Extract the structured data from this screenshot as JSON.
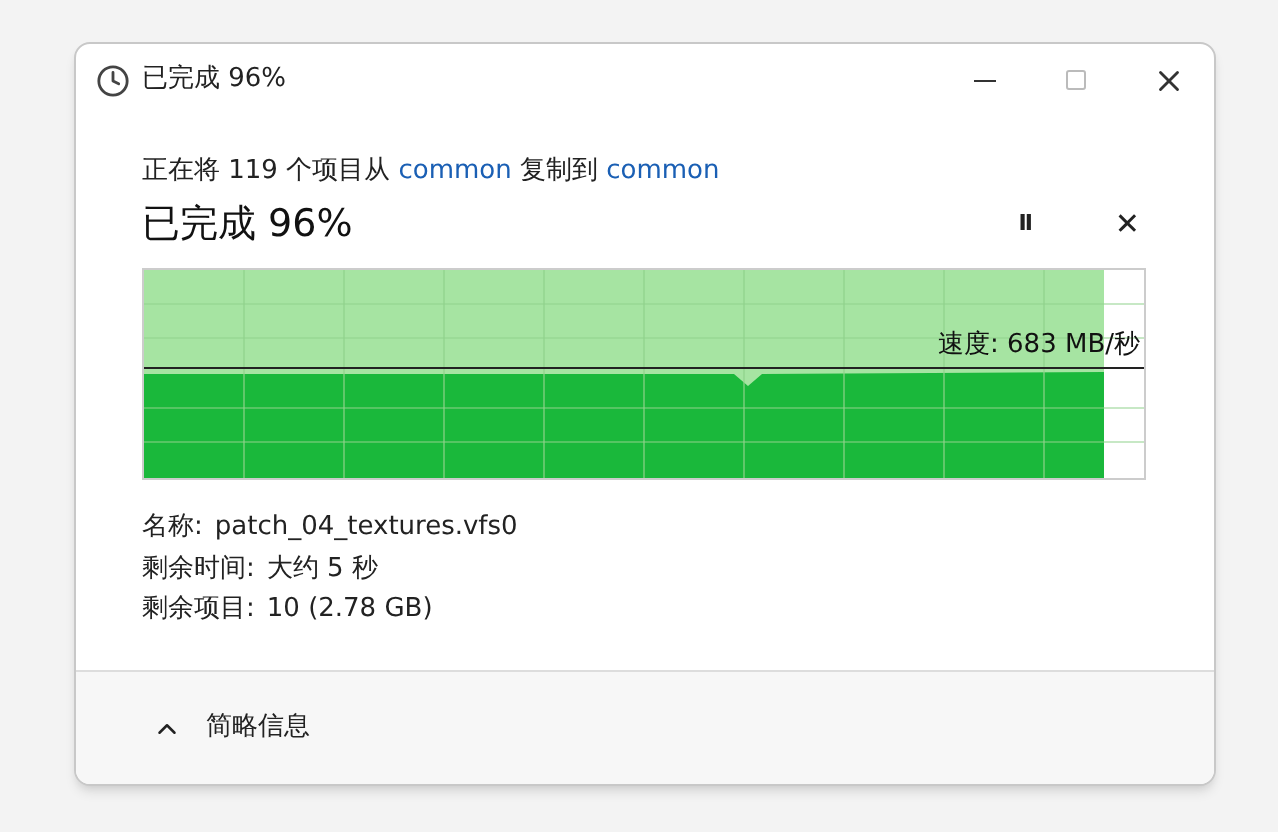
{
  "window": {
    "title": "已完成 96%",
    "maximize_disabled": true
  },
  "header": {
    "parts": [
      {
        "kind": "text",
        "text": "正在将 119 个项目从 "
      },
      {
        "kind": "link",
        "text": "common"
      },
      {
        "kind": "text",
        "text": " 复制到 "
      },
      {
        "kind": "link",
        "text": "common"
      }
    ]
  },
  "status": {
    "text": "已完成 96%",
    "pause_symbol": "II",
    "cancel_symbol": "✕"
  },
  "graph": {
    "level": 0.96,
    "speed": "速度: 683 MB/秒"
  },
  "details": [
    {
      "label": "名称:",
      "value": "patch_04_textures.vfs0"
    },
    {
      "label": "剩余时间:",
      "value": "大约 5 秒"
    },
    {
      "label": "剩余项目:",
      "value": "10 (2.78 GB)"
    }
  ],
  "footer": {
    "label": "简略信息",
    "expanded": true
  }
}
